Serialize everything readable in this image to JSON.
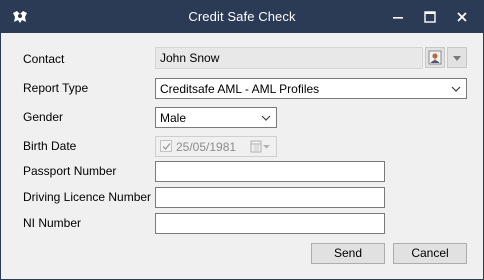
{
  "window": {
    "title": "Credit Safe Check",
    "controls": [
      "minimize-icon",
      "maximize-icon",
      "close-icon"
    ],
    "app_icon": "app-logo-icon",
    "titlebar_color": "#2b3a55"
  },
  "form": {
    "contact": {
      "label": "Contact",
      "value": "John Snow",
      "lookup_icon": "contact-card-icon"
    },
    "report_type": {
      "label": "Report Type",
      "value": "Creditsafe AML - AML Profiles"
    },
    "gender": {
      "label": "Gender",
      "value": "Male"
    },
    "birth_date": {
      "label": "Birth Date",
      "value": "25/05/1981",
      "checked": true,
      "enabled": false
    },
    "passport_number": {
      "label": "Passport Number",
      "value": ""
    },
    "driving_licence_number": {
      "label": "Driving Licence Number",
      "value": ""
    },
    "ni_number": {
      "label": "NI Number",
      "value": ""
    }
  },
  "buttons": {
    "send": "Send",
    "cancel": "Cancel"
  }
}
